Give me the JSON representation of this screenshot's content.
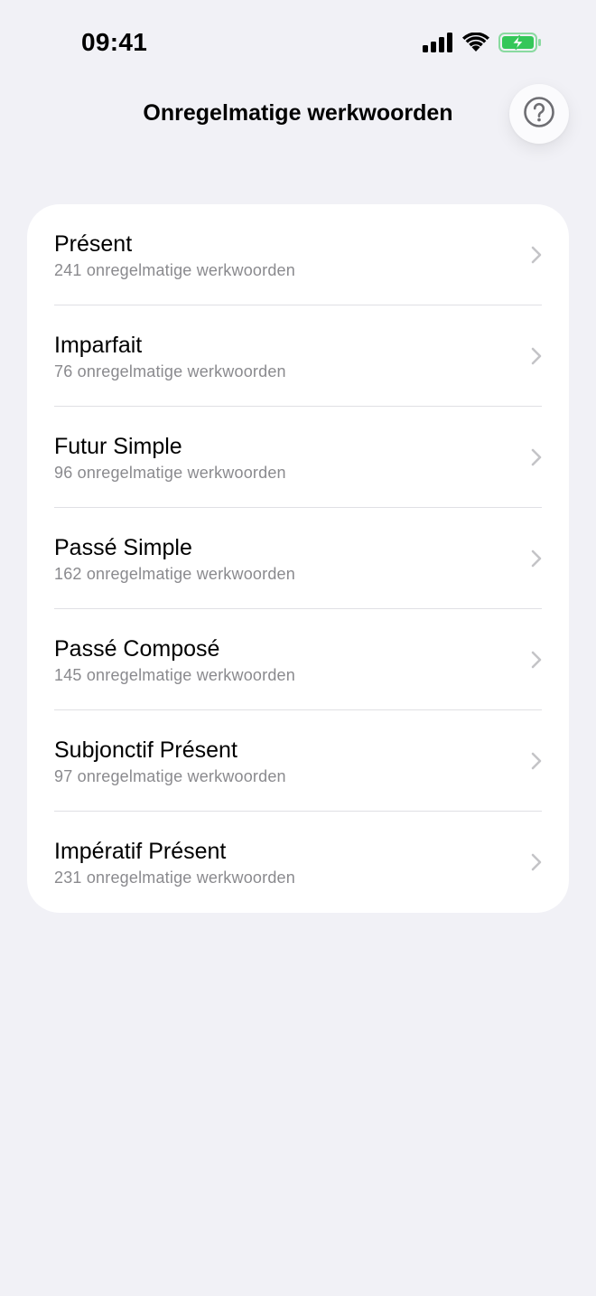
{
  "status_bar": {
    "time": "09:41",
    "icons": [
      "cellular-signal-icon",
      "wifi-icon",
      "battery-charging-icon"
    ],
    "battery_color": "#34c759"
  },
  "header": {
    "title": "Onregelmatige werkwoorden",
    "help_icon": "question-circle-icon"
  },
  "tenses": [
    {
      "title": "Présent",
      "subtitle": "241 onregelmatige werkwoorden"
    },
    {
      "title": "Imparfait",
      "subtitle": "76 onregelmatige werkwoorden"
    },
    {
      "title": "Futur Simple",
      "subtitle": "96 onregelmatige werkwoorden"
    },
    {
      "title": "Passé Simple",
      "subtitle": "162 onregelmatige werkwoorden"
    },
    {
      "title": "Passé Composé",
      "subtitle": "145 onregelmatige werkwoorden"
    },
    {
      "title": "Subjonctif Présent",
      "subtitle": "97 onregelmatige werkwoorden"
    },
    {
      "title": "Impératif Présent",
      "subtitle": "231 onregelmatige werkwoorden"
    }
  ]
}
